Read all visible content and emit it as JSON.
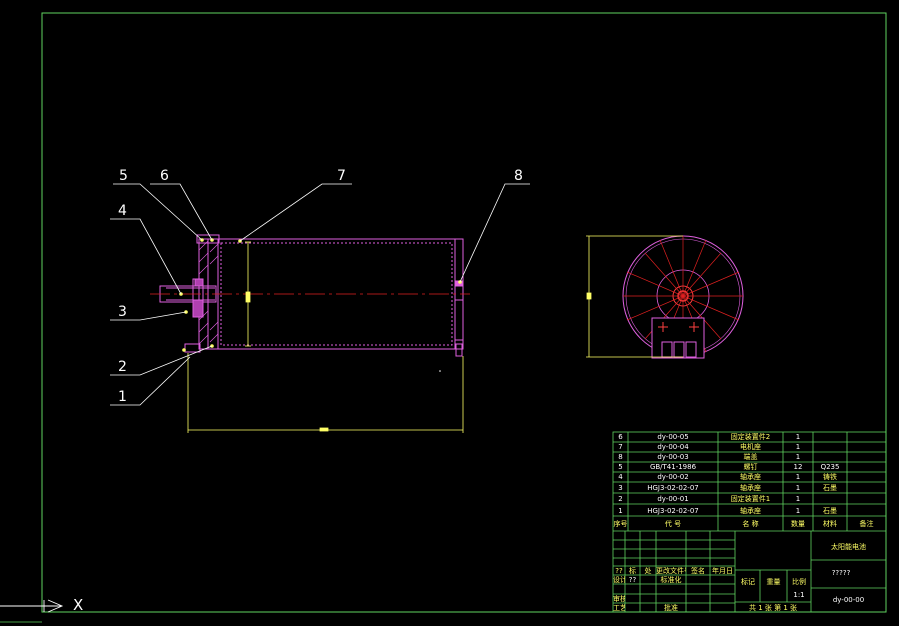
{
  "colors": {
    "frame": "#5fd35f",
    "geometry": "#e060e0",
    "center_line": "#e02020",
    "leader": "#ffffff",
    "dimension": "#ffff66",
    "text": "#ffffff",
    "title_green": "#5fd35f",
    "title_yellow": "#ffff66"
  },
  "balloons": [
    "1",
    "2",
    "3",
    "4",
    "5",
    "6",
    "7",
    "8"
  ],
  "dimensions": {
    "length": "",
    "diameter": "",
    "end_height": ""
  },
  "bom": {
    "rows": [
      {
        "no": "6",
        "code": "dy-00-05",
        "name": "固定装置件2",
        "qty": "1",
        "material": "",
        "note": ""
      },
      {
        "no": "7",
        "code": "dy-00-04",
        "name": "电机座",
        "qty": "1",
        "material": "",
        "note": ""
      },
      {
        "no": "8",
        "code": "dy-00-03",
        "name": "端盖",
        "qty": "1",
        "material": "",
        "note": ""
      },
      {
        "no": "5",
        "code": "GB/T41-1986",
        "name": "螺钉",
        "qty": "12",
        "material": "Q235",
        "note": ""
      },
      {
        "no": "4",
        "code": "dy-00-02",
        "name": "轴承座",
        "qty": "1",
        "material": "铸铁",
        "note": ""
      },
      {
        "no": "3",
        "code": "HGJ3-02-02-07",
        "name": "轴承座",
        "qty": "1",
        "material": "石墨",
        "note": ""
      },
      {
        "no": "2",
        "code": "dy-00-01",
        "name": "固定装置件1",
        "qty": "1",
        "material": "",
        "note": ""
      },
      {
        "no": "1",
        "code": "HGJ3-02-02-07",
        "name": "轴承座",
        "qty": "1",
        "material": "石墨",
        "note": ""
      }
    ],
    "header": {
      "no": "序号",
      "code": "代    号",
      "name": "名    称",
      "qty": "数量",
      "material": "材料",
      "note": "备注"
    }
  },
  "title_block": {
    "drawing_title": "太阳能电池",
    "company": "?????",
    "drawing_no": "dy-00-00",
    "scale_label": "比例",
    "scale": "1:1",
    "sheet": "共 1 张 第 1 张",
    "mark_label": "标记",
    "weight_label": "重量",
    "qty_label": "数量",
    "designer_label": "设计",
    "reviewer_label": "审核",
    "process_label": "工艺",
    "std_label": "标准化",
    "approve_label": "批准",
    "date_label": "日期",
    "marks": [
      "??",
      "标",
      "处",
      "分区",
      "更改文件号",
      "签名",
      "年月日"
    ],
    "designer_value": "??"
  },
  "ucs": {
    "x_label": "X"
  }
}
